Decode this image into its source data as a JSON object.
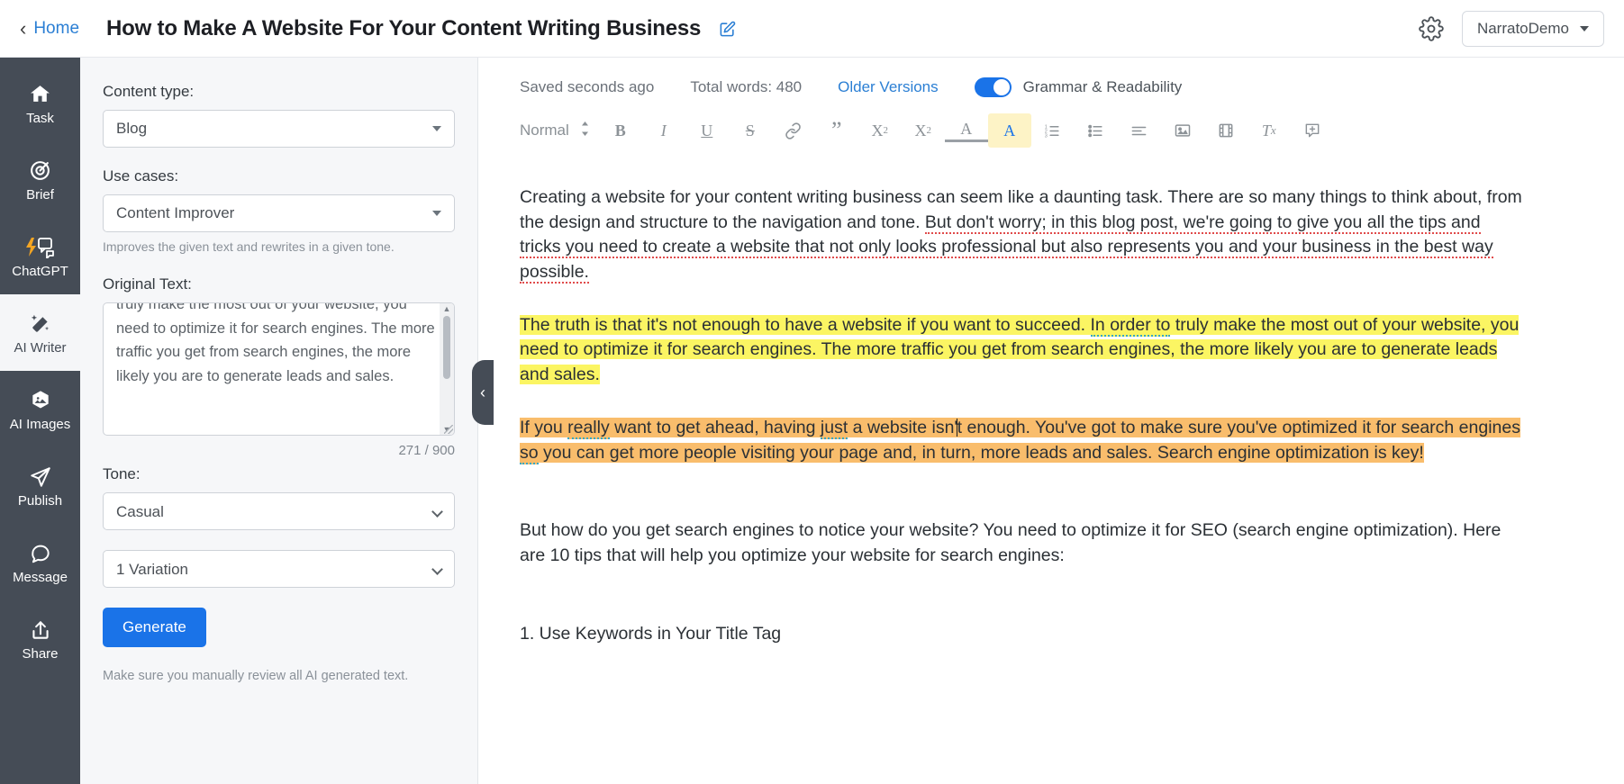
{
  "topbar": {
    "back_label": "Home",
    "back_icon": "chevron-left-icon",
    "title": "How to Make A Website For Your Content Writing Business",
    "edit_icon": "edit-pencil-icon",
    "settings_icon": "gear-icon",
    "account_label": "NarratoDemo",
    "account_caret_icon": "chevron-down-icon"
  },
  "rail": {
    "items": [
      {
        "label": "Task",
        "icon": "home-icon",
        "active": false
      },
      {
        "label": "Brief",
        "icon": "target-icon",
        "active": false
      },
      {
        "label": "ChatGPT",
        "icon": "chat-bolt-icon",
        "active": false
      },
      {
        "label": "AI Writer",
        "icon": "magic-wand-icon",
        "active": true
      },
      {
        "label": "AI Images",
        "icon": "image-hexagon-icon",
        "active": false
      },
      {
        "label": "Publish",
        "icon": "paper-plane-icon",
        "active": false
      },
      {
        "label": "Message",
        "icon": "speech-bubble-icon",
        "active": false
      },
      {
        "label": "Share",
        "icon": "upload-share-icon",
        "active": false
      }
    ]
  },
  "panel": {
    "content_type_label": "Content type:",
    "content_type_value": "Blog",
    "use_cases_label": "Use cases:",
    "use_cases_value": "Content Improver",
    "use_cases_hint": "Improves the given text and rewrites in a given tone.",
    "original_text_label": "Original Text:",
    "original_text_value": "truly make the most out of your website, you need to optimize it for search engines. The more traffic you get from search engines, the more likely you are to generate leads and sales.",
    "counter": "271 / 900",
    "tone_label": "Tone:",
    "tone_value": "Casual",
    "tone_options": [
      "Casual"
    ],
    "variation_value": "1 Variation",
    "variation_options": [
      "1 Variation"
    ],
    "generate_label": "Generate",
    "disclaimer": "Make sure you manually review all AI generated text.",
    "collapse_icon": "chevron-left-icon"
  },
  "editor": {
    "saved_status": "Saved seconds ago",
    "word_count": "Total words: 480",
    "older_versions": "Older Versions",
    "grammar_toggle_label": "Grammar & Readability",
    "grammar_toggle_on": true,
    "toolbar": {
      "style_label": "Normal",
      "items": [
        {
          "name": "style-dropdown-caret-icon",
          "glyph": "↕"
        },
        {
          "name": "bold-icon",
          "glyph": "B"
        },
        {
          "name": "italic-icon",
          "glyph": "I"
        },
        {
          "name": "underline-icon",
          "glyph": "U"
        },
        {
          "name": "strikethrough-icon",
          "glyph": "S"
        },
        {
          "name": "link-icon",
          "glyph": "🔗"
        },
        {
          "name": "blockquote-icon",
          "glyph": "”"
        },
        {
          "name": "subscript-icon",
          "glyph": "X₂"
        },
        {
          "name": "superscript-icon",
          "glyph": "X²"
        },
        {
          "name": "text-color-icon",
          "glyph": "A"
        },
        {
          "name": "highlight-color-icon",
          "glyph": "A"
        },
        {
          "name": "ordered-list-icon",
          "glyph": "≡"
        },
        {
          "name": "bullet-list-icon",
          "glyph": "≡"
        },
        {
          "name": "align-icon",
          "glyph": "≡"
        },
        {
          "name": "insert-image-icon",
          "glyph": "▣"
        },
        {
          "name": "insert-video-icon",
          "glyph": "⬛"
        },
        {
          "name": "clear-formatting-icon",
          "glyph": "Tx"
        },
        {
          "name": "add-comment-icon",
          "glyph": "⊞"
        }
      ]
    },
    "paragraphs": [
      {
        "id": "p1",
        "highlight": "none",
        "runs": [
          {
            "text": "Creating a website for your content writing business can seem like a daunting task. There are so many things to think about, from the design and structure to the navigation and tone. ",
            "mark": "none"
          },
          {
            "text": "But don't worry; in this blog post, we're going to give you all the tips and tricks you need to create a website that not only looks professional but also represents you and your business in the best way possible.",
            "mark": "grammar"
          }
        ]
      },
      {
        "id": "p2",
        "highlight": "yellow",
        "runs": [
          {
            "text": "The truth is that it's not enough to have a website if you want to succeed. ",
            "mark": "none"
          },
          {
            "text": "In order to",
            "mark": "style"
          },
          {
            "text": " truly make the most out of your website, you need to optimize it for search engines. The more traffic you get from search engines, the more likely you are to generate leads and sales.",
            "mark": "none"
          }
        ]
      },
      {
        "id": "p3",
        "highlight": "orange",
        "runs": [
          {
            "text": "If you ",
            "mark": "none"
          },
          {
            "text": "really",
            "mark": "style"
          },
          {
            "text": " want to get ahead, having ",
            "mark": "none"
          },
          {
            "text": "just",
            "mark": "style"
          },
          {
            "text": " a website isn'",
            "mark": "none"
          },
          {
            "text": "",
            "mark": "caret"
          },
          {
            "text": "t enough. You've got to make sure you've optimized it for search engines ",
            "mark": "none"
          },
          {
            "text": "so",
            "mark": "style"
          },
          {
            "text": " you can get more people visiting your page and, in turn, more leads and sales. Search engine optimization is key!",
            "mark": "none"
          }
        ]
      },
      {
        "id": "p4",
        "highlight": "none",
        "runs": [
          {
            "text": "But how do you get search engines to notice your website? You need to optimize it for SEO (search engine optimization). Here are 10 tips that will help you optimize your website for search engines:",
            "mark": "none"
          }
        ]
      },
      {
        "id": "p5",
        "highlight": "none",
        "runs": [
          {
            "text": "1. Use Keywords in Your Title Tag",
            "mark": "none"
          }
        ]
      }
    ]
  },
  "colors": {
    "accent_blue": "#1a73e8",
    "link_blue": "#2b7fd4",
    "rail_dark": "#454c56",
    "panel_bg": "#f6f7f9",
    "highlight_yellow": "#fbf563",
    "highlight_orange": "#f9bd6c",
    "grammar_red": "#e04a4a",
    "style_teal": "#37a7c4"
  }
}
